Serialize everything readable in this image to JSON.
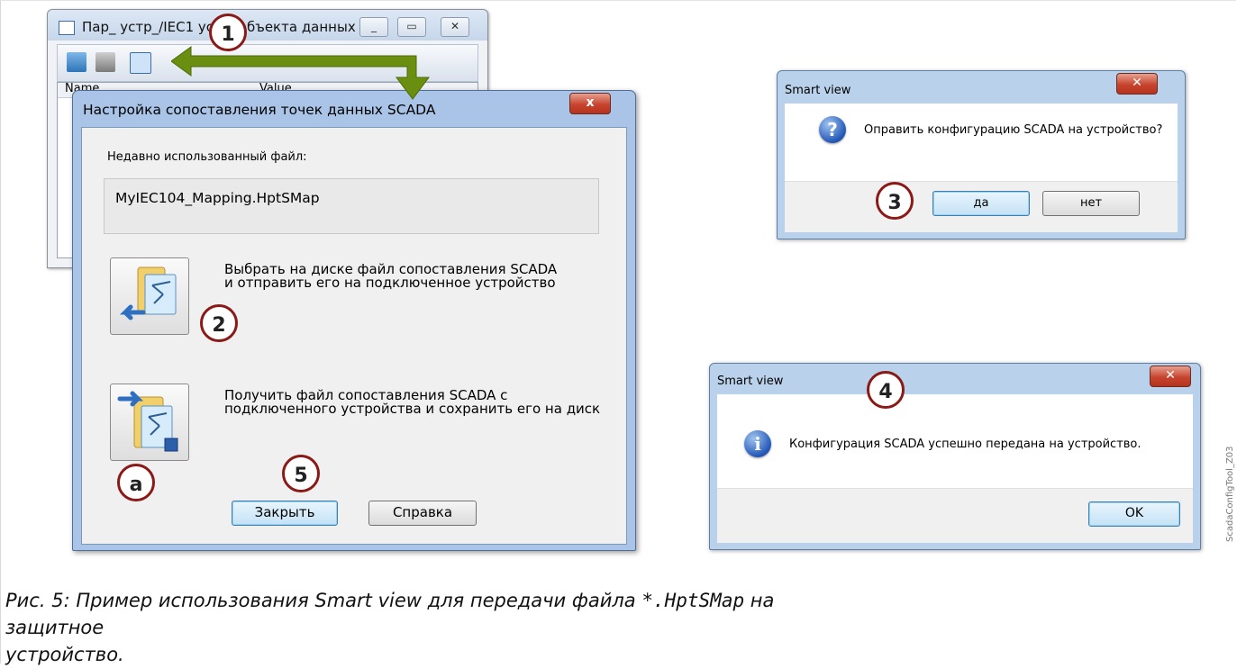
{
  "background_window": {
    "title": "Пар_ устр_/IEC1   устр. объекта данных",
    "col_name": "Name",
    "col_value": "Value",
    "icon": "data-map-icon"
  },
  "main_dialog": {
    "title": "Настройка сопоставления точек данных SCADA",
    "recent_label": "Недавно использованный файл:",
    "recent_file": "MyIEC104_Mapping.HptSMap",
    "option_send_line1": "Выбрать на диске файл сопоставления SCADA",
    "option_send_line2": "и отправить его на подключенное устройство",
    "option_receive_line1": "Получить файл сопоставления SCADA с",
    "option_receive_line2": "подключенного устройства и сохранить его на диск",
    "close_label": "Закрыть",
    "help_label": "Справка",
    "close_x": "x"
  },
  "confirm_dialog": {
    "title": "Smart view",
    "message": "Оправить конфигурацию SCADA на устройство?",
    "yes_label": "да",
    "no_label": "нет",
    "icon_glyph": "?"
  },
  "info_dialog": {
    "title": "Smart view",
    "message": "Конфигурация SCADA успешно передана на устройство.",
    "ok_label": "OK",
    "icon_glyph": "i"
  },
  "callouts": {
    "c1": "1",
    "c2": "2",
    "c3": "3",
    "c4": "4",
    "c5": "5",
    "ca": "a"
  },
  "caption": {
    "prefix": "Рис. 5: Пример использования Smart view для передачи файла ",
    "filename": "*.HptSMap",
    "suffix": " на защитное",
    "line2": "устройство."
  },
  "figure_ref": "ScadaConfigTool_Z03",
  "colors": {
    "arrow": "#6a8f10",
    "callout_border": "#8a1a18",
    "close_button": "#c7452f"
  }
}
